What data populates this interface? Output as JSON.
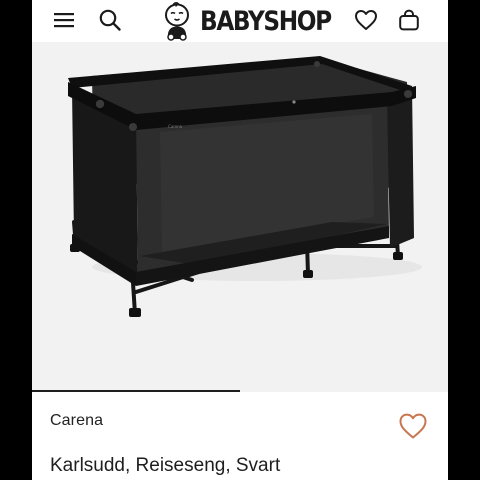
{
  "header": {
    "menu_icon": "hamburger-menu-icon",
    "search_icon": "search-icon",
    "logo_text": "BABYSHOP",
    "wishlist_icon": "heart-icon",
    "cart_icon": "shopping-bag-icon"
  },
  "product": {
    "image_subject": "black travel cot",
    "crib_label": "Carena",
    "brand": "Carena",
    "title": "Karlsudd, Reiseseng, Svart",
    "wishlist_icon": "heart-outline-icon",
    "accent_color": "#c8764f",
    "gallery_position": 0.5
  }
}
